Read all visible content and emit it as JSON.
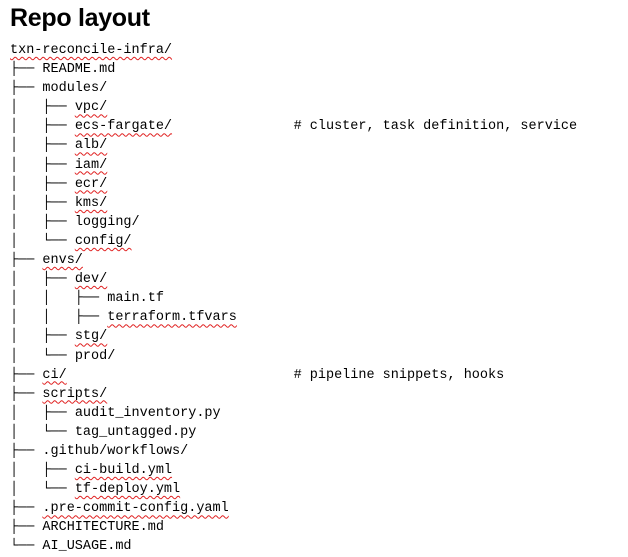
{
  "title": "Repo layout",
  "tree": [
    {
      "prefix": "",
      "name": "txn-reconcile-infra/",
      "squiggle": true,
      "comment": ""
    },
    {
      "prefix": "├── ",
      "name": "README.md",
      "squiggle": false,
      "comment": ""
    },
    {
      "prefix": "├── ",
      "name": "modules/",
      "squiggle": false,
      "comment": ""
    },
    {
      "prefix": "│   ├── ",
      "name": "vpc/",
      "squiggle": true,
      "comment": ""
    },
    {
      "prefix": "│   ├── ",
      "name": "ecs-fargate/",
      "squiggle": true,
      "comment": "# cluster, task definition, service"
    },
    {
      "prefix": "│   ├── ",
      "name": "alb/",
      "squiggle": true,
      "comment": ""
    },
    {
      "prefix": "│   ├── ",
      "name": "iam/",
      "squiggle": true,
      "comment": ""
    },
    {
      "prefix": "│   ├── ",
      "name": "ecr/",
      "squiggle": true,
      "comment": ""
    },
    {
      "prefix": "│   ├── ",
      "name": "kms/",
      "squiggle": true,
      "comment": ""
    },
    {
      "prefix": "│   ├── ",
      "name": "logging/",
      "squiggle": false,
      "comment": ""
    },
    {
      "prefix": "│   └── ",
      "name": "config/",
      "squiggle": true,
      "comment": ""
    },
    {
      "prefix": "├── ",
      "name": "envs/",
      "squiggle": true,
      "comment": ""
    },
    {
      "prefix": "│   ├── ",
      "name": "dev/",
      "squiggle": true,
      "comment": ""
    },
    {
      "prefix": "│   │   ├── ",
      "name": "main.tf",
      "squiggle": false,
      "comment": ""
    },
    {
      "prefix": "│   │   ├── ",
      "name": "terraform.tfvars",
      "squiggle": true,
      "comment": ""
    },
    {
      "prefix": "│   ├── ",
      "name": "stg/",
      "squiggle": true,
      "comment": ""
    },
    {
      "prefix": "│   └── ",
      "name": "prod/",
      "squiggle": false,
      "comment": ""
    },
    {
      "prefix": "├── ",
      "name": "ci/",
      "squiggle": true,
      "comment": "# pipeline snippets, hooks"
    },
    {
      "prefix": "├── ",
      "name": "scripts/",
      "squiggle": true,
      "comment": ""
    },
    {
      "prefix": "│   ├── ",
      "name": "audit_inventory.py",
      "squiggle": false,
      "comment": ""
    },
    {
      "prefix": "│   └── ",
      "name": "tag_untagged.py",
      "squiggle": false,
      "comment": ""
    },
    {
      "prefix": "├── ",
      "name": ".github/workflows/",
      "squiggle": false,
      "comment": ""
    },
    {
      "prefix": "│   ├── ",
      "name": "ci-build.yml",
      "squiggle": true,
      "comment": ""
    },
    {
      "prefix": "│   └── ",
      "name": "tf-deploy.yml",
      "squiggle": true,
      "comment": ""
    },
    {
      "prefix": "├── ",
      "name": ".pre-commit-config.yaml",
      "squiggle": true,
      "comment": ""
    },
    {
      "prefix": "├── ",
      "name": "ARCHITECTURE.md",
      "squiggle": false,
      "comment": ""
    },
    {
      "prefix": "└── ",
      "name": "AI_USAGE.md",
      "squiggle": false,
      "comment": ""
    }
  ]
}
